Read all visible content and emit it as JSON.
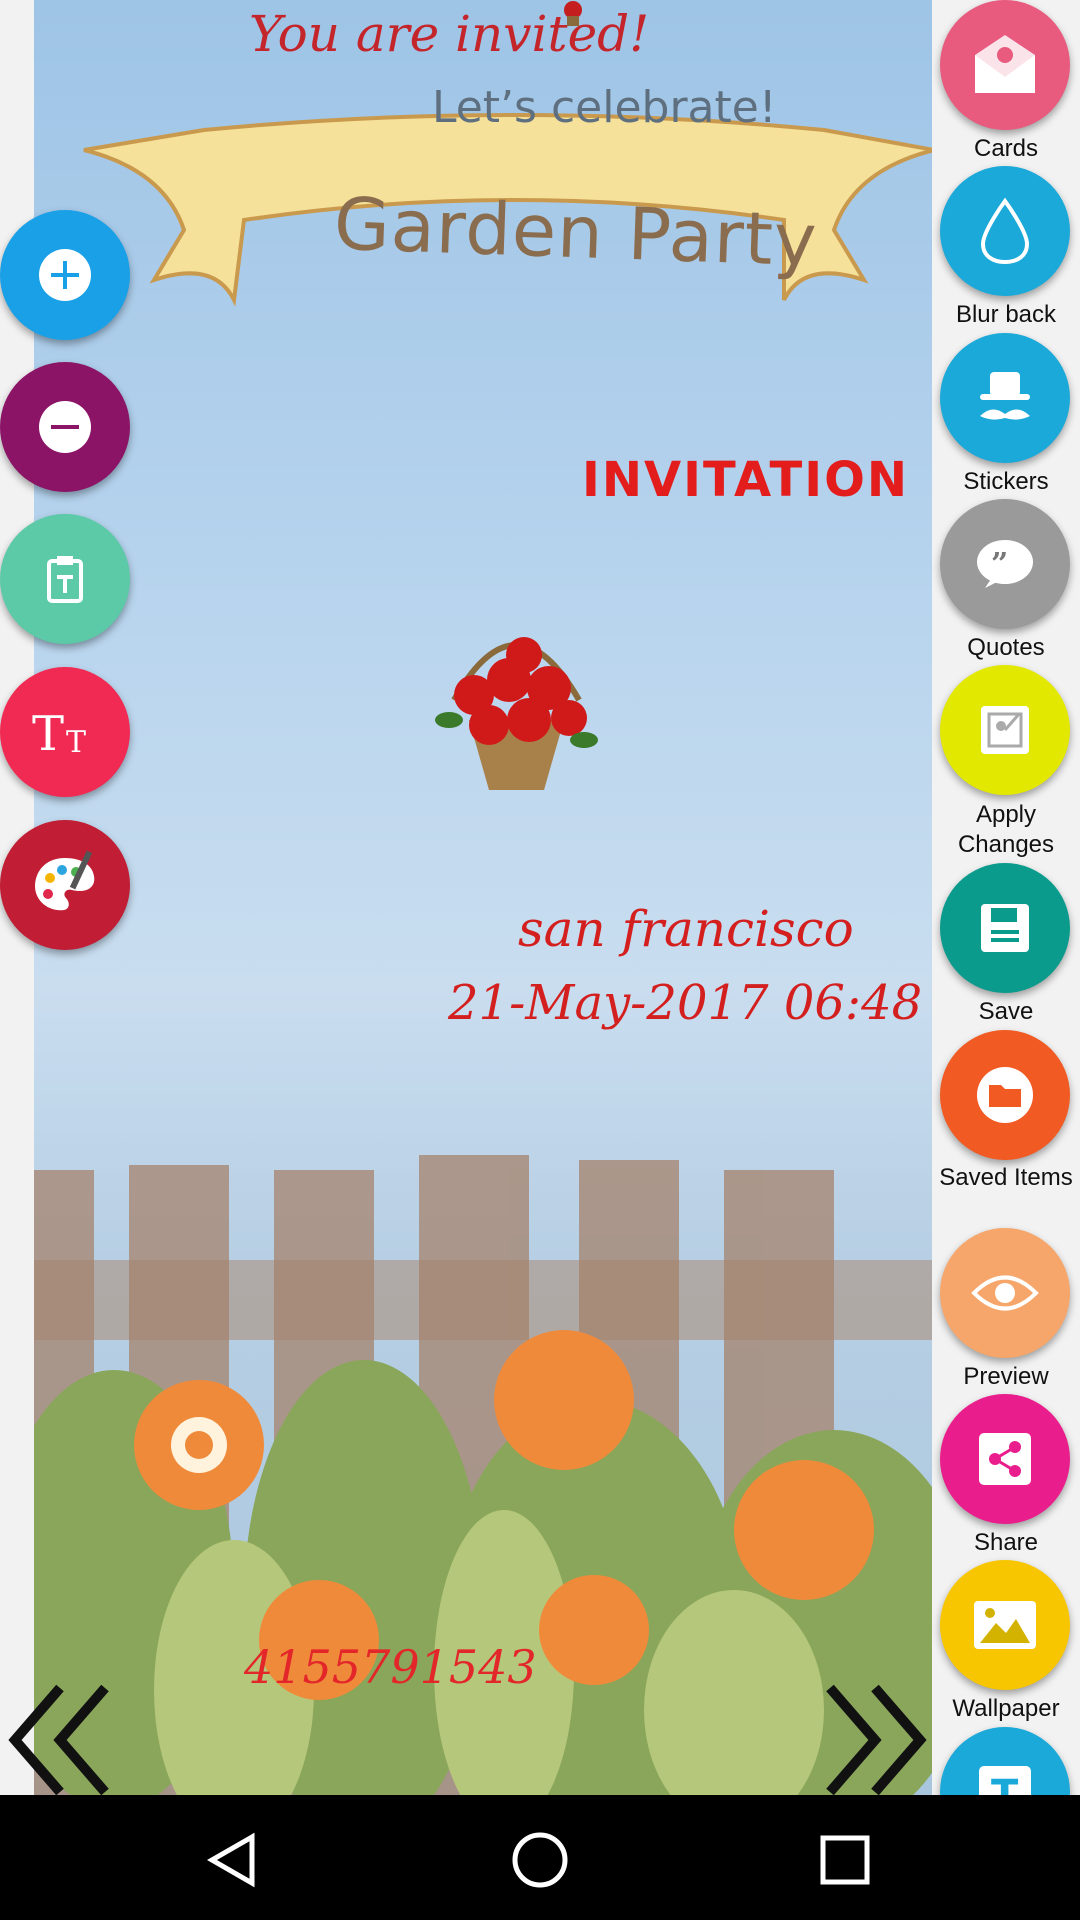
{
  "card": {
    "invited": "You are invited!",
    "celebrate": "Let’s celebrate!",
    "banner": "Garden Party",
    "invitation": "INVITATION",
    "city": "san francisco",
    "datetime": "21-May-2017 06:48",
    "phone": "4155791543"
  },
  "left_tools": [
    {
      "name": "zoom-in-button",
      "icon": "plus-icon",
      "color": "#1aa0e6"
    },
    {
      "name": "zoom-out-button",
      "icon": "minus-icon",
      "color": "#8c1467"
    },
    {
      "name": "paste-text-button",
      "icon": "clipboard-text-icon",
      "color": "#5cc9a7"
    },
    {
      "name": "text-size-button",
      "icon": "text-size-icon",
      "color": "#f02a52"
    },
    {
      "name": "color-palette-button",
      "icon": "palette-icon",
      "color": "#c11d34"
    }
  ],
  "right_menu": [
    {
      "label": "Cards",
      "icon": "envelope-icon",
      "color": "#e85a7e"
    },
    {
      "label": "Blur back",
      "icon": "drop-icon",
      "color": "#1aa9d9"
    },
    {
      "label": "Stickers",
      "icon": "hat-mustache-icon",
      "color": "#1aa9d9"
    },
    {
      "label": "Quotes",
      "icon": "quote-icon",
      "color": "#9a9a9a"
    },
    {
      "label": "Apply Changes",
      "icon": "apply-icon",
      "color": "#e2e800"
    },
    {
      "label": "Save",
      "icon": "floppy-icon",
      "color": "#0a9b8c"
    },
    {
      "label": "Saved Items",
      "icon": "folder-icon",
      "color": "#f15a22"
    },
    {
      "label": "Preview",
      "icon": "eye-icon",
      "color": "#f6a66a"
    },
    {
      "label": "Share",
      "icon": "share-icon",
      "color": "#e91e8c"
    },
    {
      "label": "Wallpaper",
      "icon": "image-icon",
      "color": "#f7c600"
    },
    {
      "label": "",
      "icon": "text-icon",
      "color": "#1aa9d9"
    }
  ],
  "nav": {
    "back": "back-icon",
    "home": "home-icon",
    "recents": "recents-icon"
  }
}
